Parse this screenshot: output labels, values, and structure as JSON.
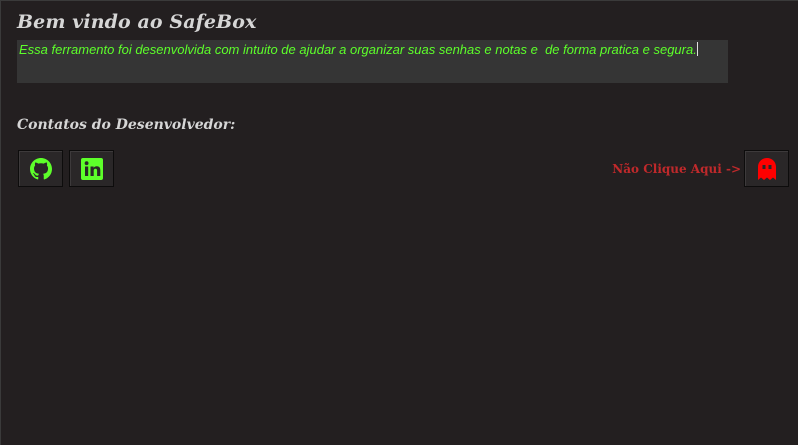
{
  "header": {
    "title": "Bem vindo ao SafeBox"
  },
  "description": {
    "text": "Essa ferramento foi desenvolvida com intuito de ajudar a organizar suas senhas e notas e  de forma pratica e segura."
  },
  "contacts": {
    "heading": "Contatos do Desenvolvedor:",
    "buttons": [
      {
        "icon": "github-icon"
      },
      {
        "icon": "linkedin-icon"
      }
    ]
  },
  "secret": {
    "label": "Não Clique Aqui ->",
    "icon": "ghost-icon"
  },
  "colors": {
    "background": "#231f20",
    "accent_green": "#5dff2a",
    "warning_red": "#c0292b",
    "ghost_red": "#ff0000",
    "text_light": "#d6d6d6"
  }
}
